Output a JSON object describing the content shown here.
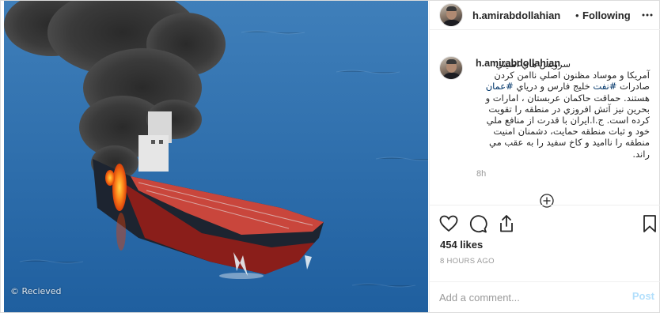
{
  "photo": {
    "description_icon": "oil-tanker-fire-photo",
    "watermark": "© Recieved"
  },
  "header": {
    "username": "h.amirabdollahian",
    "separator": "•",
    "follow_status": "Following",
    "more_icon": "ellipsis-icon"
  },
  "caption": {
    "username": "h.amirabdollahian",
    "text_line1": "سرويس هاي امنيتي",
    "text_line2": "آمريکا و موساد مظنون اصلي ناامن کردن",
    "text_line3_a": "صادرات ",
    "hashtag1": "#نفت",
    "text_line3_b": " خليج فارس و درياي ",
    "hashtag2": "#عمان",
    "text_rest": "هستند. حماقت حاکمان عربستان ، امارات و بحرين نيز آتش افروزي در منطقه را تقويت کرده است. ج.ا.ايران با قدرت از منافع ملي خود و ثبات منطقه حمايت، دشمنان امنيت منطقه را نااميد و کاخ سفيد را به عقب مي راند.",
    "time_ago": "8h",
    "load_more_icon": "plus-circle-icon"
  },
  "actions": {
    "like_icon": "heart-icon",
    "comment_icon": "comment-bubble-icon",
    "share_icon": "share-icon",
    "save_icon": "bookmark-icon",
    "likes": "454 likes",
    "posted": "8 HOURS AGO"
  },
  "comment_box": {
    "placeholder": "Add a comment...",
    "post_label": "Post"
  }
}
